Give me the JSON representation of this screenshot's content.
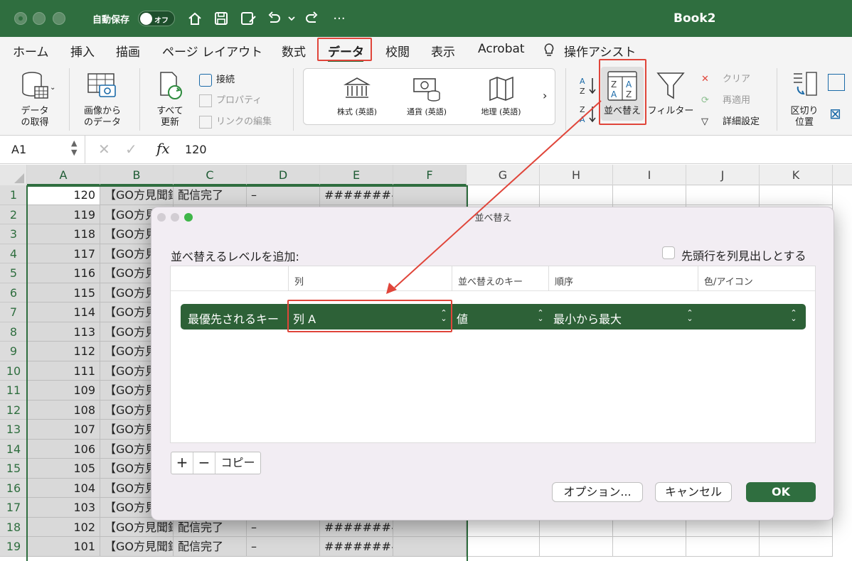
{
  "titlebar": {
    "autosave": "自動保存",
    "toggle": "オフ",
    "book": "Book2"
  },
  "tabs": [
    "ホーム",
    "挿入",
    "描画",
    "ページ レイアウト",
    "数式",
    "データ",
    "校閲",
    "表示",
    "Acrobat",
    "操作アシスト"
  ],
  "ribbon": {
    "get_data": [
      "データ",
      "の取得"
    ],
    "from_picture": [
      "画像から",
      "のデータ"
    ],
    "refresh_all": [
      "すべて",
      "更新"
    ],
    "connections": "接続",
    "properties": "プロパティ",
    "edit_links": "リンクの編集",
    "datatypes": [
      "株式 (英語)",
      "通貨 (英語)",
      "地理 (英語)"
    ],
    "sort": "並べ替え",
    "filter": "フィルター",
    "clear": "クリア",
    "reapply": "再適用",
    "advanced": "詳細設定",
    "text_to_columns": [
      "区切り",
      "位置"
    ]
  },
  "formula": {
    "cell": "A1",
    "fx": "fx",
    "value": "120"
  },
  "columns": [
    "A",
    "B",
    "C",
    "D",
    "E",
    "F",
    "G",
    "H",
    "I",
    "J",
    "K"
  ],
  "rows": [
    {
      "n": "1",
      "a": "120",
      "b": "【GO方見聞録",
      "c": "配信完了",
      "d": "–",
      "e": "##########"
    },
    {
      "n": "2",
      "a": "119",
      "b": "【GO方見",
      "c": "",
      "d": "",
      "e": ""
    },
    {
      "n": "3",
      "a": "118",
      "b": "【GO方見",
      "c": "",
      "d": "",
      "e": ""
    },
    {
      "n": "4",
      "a": "117",
      "b": "【GO方見",
      "c": "",
      "d": "",
      "e": ""
    },
    {
      "n": "5",
      "a": "116",
      "b": "【GO方見",
      "c": "",
      "d": "",
      "e": ""
    },
    {
      "n": "6",
      "a": "115",
      "b": "【GO方見",
      "c": "",
      "d": "",
      "e": ""
    },
    {
      "n": "7",
      "a": "114",
      "b": "【GO方見",
      "c": "",
      "d": "",
      "e": ""
    },
    {
      "n": "8",
      "a": "113",
      "b": "【GO方見",
      "c": "",
      "d": "",
      "e": ""
    },
    {
      "n": "9",
      "a": "112",
      "b": "【GO方見",
      "c": "",
      "d": "",
      "e": ""
    },
    {
      "n": "10",
      "a": "111",
      "b": "【GO方見",
      "c": "",
      "d": "",
      "e": ""
    },
    {
      "n": "11",
      "a": "109",
      "b": "【GO方見",
      "c": "",
      "d": "",
      "e": ""
    },
    {
      "n": "12",
      "a": "108",
      "b": "【GO方見",
      "c": "",
      "d": "",
      "e": ""
    },
    {
      "n": "13",
      "a": "107",
      "b": "【GO方見",
      "c": "",
      "d": "",
      "e": ""
    },
    {
      "n": "14",
      "a": "106",
      "b": "【GO方見",
      "c": "",
      "d": "",
      "e": ""
    },
    {
      "n": "15",
      "a": "105",
      "b": "【GO方見",
      "c": "",
      "d": "",
      "e": ""
    },
    {
      "n": "16",
      "a": "104",
      "b": "【GO方見",
      "c": "",
      "d": "",
      "e": ""
    },
    {
      "n": "17",
      "a": "103",
      "b": "【GO方見",
      "c": "",
      "d": "",
      "e": ""
    },
    {
      "n": "18",
      "a": "102",
      "b": "【GO方見聞録",
      "c": "配信完了",
      "d": "–",
      "e": "##########"
    },
    {
      "n": "19",
      "a": "101",
      "b": "【GO方見聞録",
      "c": "配信完了",
      "d": "–",
      "e": "##########"
    }
  ],
  "dialog": {
    "title": "並べ替え",
    "add_level": "並べ替えるレベルを追加:",
    "header_checkbox": "先頭行を列見出しとする",
    "col_headers": [
      "列",
      "並べ替えのキー",
      "順序",
      "色/アイコン"
    ],
    "row_label": "最優先されるキー",
    "column": "列 A",
    "key": "値",
    "order": "最小から最大",
    "plus": "+",
    "minus": "−",
    "copy": "コピー",
    "options": "オプション...",
    "cancel": "キャンセル",
    "ok": "OK"
  }
}
